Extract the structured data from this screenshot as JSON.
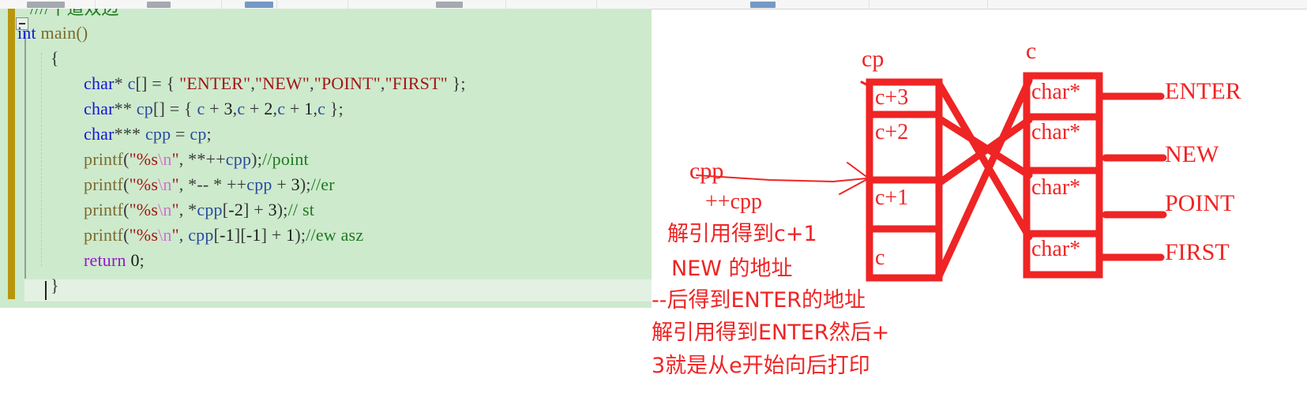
{
  "toolbar": {
    "visible_fragment": ""
  },
  "editor": {
    "top_comment": "////十道双边",
    "lines": [
      {
        "indent": 0,
        "tokens": [
          {
            "t": "int ",
            "c": "kw"
          },
          {
            "t": "main",
            "c": "fn"
          },
          {
            "t": "()",
            "c": "fn"
          }
        ]
      },
      {
        "indent": 1,
        "tokens": [
          {
            "t": "{",
            "c": "pl"
          }
        ]
      },
      {
        "indent": 2,
        "tokens": [
          {
            "t": "char",
            "c": "kw"
          },
          {
            "t": "* ",
            "c": "pl"
          },
          {
            "t": "c",
            "c": "id"
          },
          {
            "t": "[] = { ",
            "c": "pl"
          },
          {
            "t": "\"ENTER\"",
            "c": "str"
          },
          {
            "t": ",",
            "c": "pl"
          },
          {
            "t": "\"NEW\"",
            "c": "str"
          },
          {
            "t": ",",
            "c": "pl"
          },
          {
            "t": "\"POINT\"",
            "c": "str"
          },
          {
            "t": ",",
            "c": "pl"
          },
          {
            "t": "\"FIRST\"",
            "c": "str"
          },
          {
            "t": " };",
            "c": "pl"
          }
        ]
      },
      {
        "indent": 2,
        "tokens": [
          {
            "t": "char",
            "c": "kw"
          },
          {
            "t": "** ",
            "c": "pl"
          },
          {
            "t": "cp",
            "c": "id"
          },
          {
            "t": "[] = { ",
            "c": "pl"
          },
          {
            "t": "c",
            "c": "id"
          },
          {
            "t": " + ",
            "c": "pl"
          },
          {
            "t": "3",
            "c": "num"
          },
          {
            "t": ",",
            "c": "pl"
          },
          {
            "t": "c",
            "c": "id"
          },
          {
            "t": " + ",
            "c": "pl"
          },
          {
            "t": "2",
            "c": "num"
          },
          {
            "t": ",",
            "c": "pl"
          },
          {
            "t": "c",
            "c": "id"
          },
          {
            "t": " + ",
            "c": "pl"
          },
          {
            "t": "1",
            "c": "num"
          },
          {
            "t": ",",
            "c": "pl"
          },
          {
            "t": "c",
            "c": "id"
          },
          {
            "t": " };",
            "c": "pl"
          }
        ]
      },
      {
        "indent": 2,
        "tokens": [
          {
            "t": "char",
            "c": "kw"
          },
          {
            "t": "*** ",
            "c": "pl"
          },
          {
            "t": "cpp",
            "c": "id"
          },
          {
            "t": " = ",
            "c": "pl"
          },
          {
            "t": "cp",
            "c": "id"
          },
          {
            "t": ";",
            "c": "pl"
          }
        ]
      },
      {
        "indent": 2,
        "tokens": [
          {
            "t": "printf",
            "c": "fn"
          },
          {
            "t": "(",
            "c": "pl"
          },
          {
            "t": "\"%s",
            "c": "str"
          },
          {
            "t": "\\n",
            "c": "esc"
          },
          {
            "t": "\"",
            "c": "str"
          },
          {
            "t": ", **++",
            "c": "pl"
          },
          {
            "t": "cpp",
            "c": "id"
          },
          {
            "t": ");",
            "c": "pl"
          },
          {
            "t": "//point",
            "c": "cm"
          }
        ]
      },
      {
        "indent": 2,
        "tokens": [
          {
            "t": "printf",
            "c": "fn"
          },
          {
            "t": "(",
            "c": "pl"
          },
          {
            "t": "\"%s",
            "c": "str"
          },
          {
            "t": "\\n",
            "c": "esc"
          },
          {
            "t": "\"",
            "c": "str"
          },
          {
            "t": ", *-- * ++",
            "c": "pl"
          },
          {
            "t": "cpp",
            "c": "id"
          },
          {
            "t": " + ",
            "c": "pl"
          },
          {
            "t": "3",
            "c": "num"
          },
          {
            "t": ");",
            "c": "pl"
          },
          {
            "t": "//er",
            "c": "cm"
          }
        ]
      },
      {
        "indent": 2,
        "tokens": [
          {
            "t": "printf",
            "c": "fn"
          },
          {
            "t": "(",
            "c": "pl"
          },
          {
            "t": "\"%s",
            "c": "str"
          },
          {
            "t": "\\n",
            "c": "esc"
          },
          {
            "t": "\"",
            "c": "str"
          },
          {
            "t": ", *",
            "c": "pl"
          },
          {
            "t": "cpp",
            "c": "id"
          },
          {
            "t": "[",
            "c": "pl"
          },
          {
            "t": "-2",
            "c": "num"
          },
          {
            "t": "] + ",
            "c": "pl"
          },
          {
            "t": "3",
            "c": "num"
          },
          {
            "t": ");",
            "c": "pl"
          },
          {
            "t": "// st",
            "c": "cm"
          }
        ]
      },
      {
        "indent": 2,
        "tokens": [
          {
            "t": "printf",
            "c": "fn"
          },
          {
            "t": "(",
            "c": "pl"
          },
          {
            "t": "\"%s",
            "c": "str"
          },
          {
            "t": "\\n",
            "c": "esc"
          },
          {
            "t": "\"",
            "c": "str"
          },
          {
            "t": ", ",
            "c": "pl"
          },
          {
            "t": "cpp",
            "c": "id"
          },
          {
            "t": "[",
            "c": "pl"
          },
          {
            "t": "-1",
            "c": "num"
          },
          {
            "t": "][",
            "c": "pl"
          },
          {
            "t": "-1",
            "c": "num"
          },
          {
            "t": "] + ",
            "c": "pl"
          },
          {
            "t": "1",
            "c": "num"
          },
          {
            "t": ");",
            "c": "pl"
          },
          {
            "t": "//ew asz",
            "c": "cm"
          }
        ]
      },
      {
        "indent": 2,
        "tokens": [
          {
            "t": "return",
            "c": "kw2"
          },
          {
            "t": " ",
            "c": "pl"
          },
          {
            "t": "0",
            "c": "num"
          },
          {
            "t": ";",
            "c": "pl"
          }
        ]
      },
      {
        "indent": 1,
        "tokens": [
          {
            "t": "}",
            "c": "pl"
          }
        ]
      }
    ],
    "code_text": "int main()\n{\n    char* c[] = { \"ENTER\",\"NEW\",\"POINT\",\"FIRST\" };\n    char** cp[] = { c + 3,c + 2,c + 1,c };\n    char*** cpp = cp;\n    printf(\"%s\\n\", **++cpp);//point\n    printf(\"%s\\n\", *-- * ++cpp + 3);//er\n    printf(\"%s\\n\", *cpp[-2] + 3);// st\n    printf(\"%s\\n\", cpp[-1][-1] + 1);//ew asz\n    return 0;\n}"
  },
  "diagram": {
    "ink_color": "#ef2424",
    "cp_array": {
      "label": "cp",
      "cells": [
        "c+3",
        "c+2",
        "c+1",
        "c"
      ]
    },
    "c_array": {
      "label": "c",
      "cells": [
        "char*",
        "char*",
        "char*",
        "char*"
      ]
    },
    "strings": [
      "ENTER",
      "NEW",
      "POINT",
      "FIRST"
    ],
    "pointer_label": "cpp",
    "annotations": [
      "++cpp",
      "解引用得到c+1",
      "NEW 的地址",
      "--后得到ENTER的地址",
      "解引用得到ENTER然后+",
      "3就是从e开始向后打印"
    ]
  }
}
